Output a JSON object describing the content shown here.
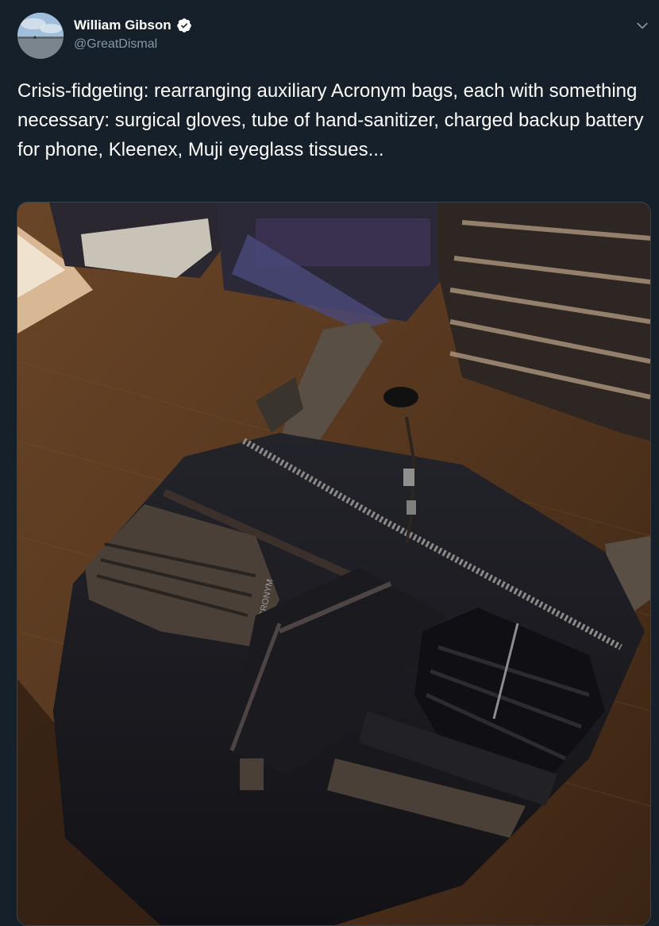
{
  "tweet": {
    "author": {
      "display_name": "William Gibson",
      "handle": "@GreatDismal",
      "verified": true,
      "avatar_icon": "avatar-photo"
    },
    "text": "Crisis-fidgeting: rearranging auxiliary Acronym bags, each with something necessary: surgical gloves, tube of hand-sanitizer, charged backup battery for phone, Kleenex, Muji eyeglass tissues...",
    "menu_icon": "chevron-down-icon",
    "media": {
      "icon": "photo",
      "bag_labels": [
        "ACRONYM"
      ]
    }
  },
  "colors": {
    "background": "#15202b",
    "text_primary": "#ffffff",
    "text_secondary": "#8899a6",
    "verified_badge": "#ffffff",
    "border": "#38444d"
  }
}
